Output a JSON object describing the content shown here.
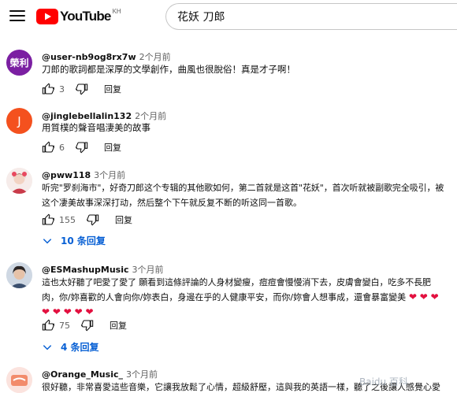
{
  "header": {
    "logo_text": "YouTube",
    "logo_region": "KH",
    "search_value": "花妖 刀郎"
  },
  "comments": [
    {
      "avatar_text": "榮利",
      "avatar_color": "#7b1fa2",
      "author": "@user-nb9og8rx7w",
      "time": "2个月前",
      "text": "刀郎的歌詞都是深厚的文學創作，曲風也很脫俗！真是才子啊！",
      "likes": "3",
      "reply_label": "回复"
    },
    {
      "avatar_text": "J",
      "avatar_color": "#f4511e",
      "author": "@jinglebellalin132",
      "time": "2个月前",
      "text": "用質樸的聲音唱淒美的故事",
      "likes": "6",
      "reply_label": "回复"
    },
    {
      "author": "@pww118",
      "time": "3个月前",
      "text_line1": "听完\"罗刹海市\"，好奇刀郎这个专辑的其他歌如何，第二首就是这首\"花妖\"，首次听就被副歌完全吸引，被",
      "text_line2": "这个凄美故事深深打动，然后整个下午就反复不断的听这同一首歌。",
      "likes": "155",
      "reply_label": "回复",
      "replies_label": "10 条回复"
    },
    {
      "author": "@ESMashupMusic",
      "time": "3个月前",
      "text_line1": "這也太好聽了吧愛了愛了 願看到這條評論的人身材變瘦，痘痘會慢慢消下去，皮膚會變白，吃多不長肥",
      "text_line2": "肉，你/妳喜歡的人會向你/妳表白，身邊在乎的人健康平安，而你/妳會人想事成，還會暴富變美",
      "likes": "75",
      "reply_label": "回复",
      "replies_label": "4 条回复"
    },
    {
      "author": "@Orange_Music_",
      "time": "3个月前",
      "text": "很好聽，非常喜愛這些音樂，它讓我放鬆了心情，超級舒壓，這與我的英語一樣，聽了之後讓人感覺心愛"
    }
  ],
  "watermark": "Baidu 百科",
  "icons": {
    "menu": "menu-icon",
    "like": "thumbs-up-icon",
    "dislike": "thumbs-down-icon",
    "expand": "chevron-down-icon",
    "heart": "heart-emoji"
  },
  "colors": {
    "link_blue": "#065fd4",
    "youtube_red": "#ff0000",
    "heart_red": "#e3103f"
  }
}
